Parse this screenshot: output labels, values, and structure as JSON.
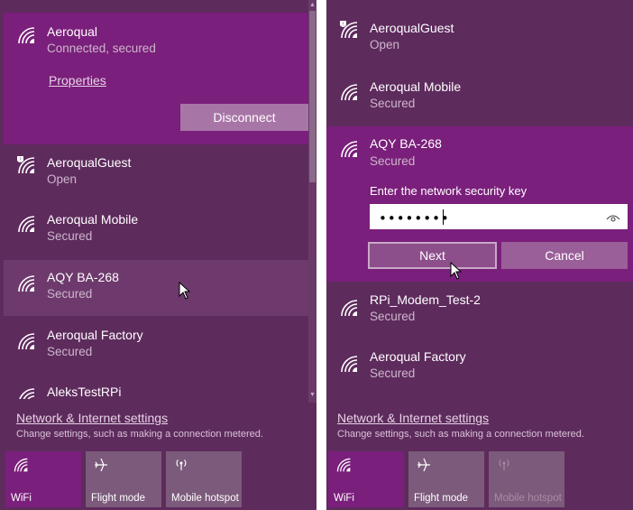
{
  "left_panel": {
    "connected_network": {
      "name": "Aeroqual",
      "status": "Connected, secured",
      "properties_link": "Properties",
      "disconnect_label": "Disconnect"
    },
    "networks": [
      {
        "name": "AeroqualGuest",
        "status": "Open",
        "icon": "wifi-shield-icon"
      },
      {
        "name": "Aeroqual Mobile",
        "status": "Secured",
        "icon": "wifi-icon"
      },
      {
        "name": "AQY BA-268",
        "status": "Secured",
        "icon": "wifi-icon"
      },
      {
        "name": "Aeroqual Factory",
        "status": "Secured",
        "icon": "wifi-icon"
      },
      {
        "name": "AleksTestRPi",
        "status": "",
        "icon": "wifi-icon"
      }
    ]
  },
  "right_panel": {
    "networks": [
      {
        "name": "AeroqualGuest",
        "status": "Open",
        "icon": "wifi-shield-icon"
      },
      {
        "name": "Aeroqual Mobile",
        "status": "Secured",
        "icon": "wifi-icon"
      },
      {
        "name": "AQY BA-268",
        "status": "Secured",
        "icon": "wifi-icon"
      },
      {
        "name": "RPi_Modem_Test-2",
        "status": "Secured",
        "icon": "wifi-icon"
      },
      {
        "name": "Aeroqual Factory",
        "status": "Secured",
        "icon": "wifi-icon"
      }
    ],
    "security_prompt": "Enter the network security key",
    "password_value": "••••••••",
    "next_label": "Next",
    "cancel_label": "Cancel"
  },
  "settings": {
    "title": "Network & Internet settings",
    "description": "Change settings, such as making a connection metered."
  },
  "quick_actions": {
    "wifi": "WiFi",
    "flight_mode": "Flight mode",
    "mobile_hotspot": "Mobile hotspot"
  },
  "colors": {
    "panel_bg": "#5e2b5d",
    "accent": "#7a1f7b",
    "hover": "#6e3a6d",
    "tile": "#7c5a7b"
  }
}
